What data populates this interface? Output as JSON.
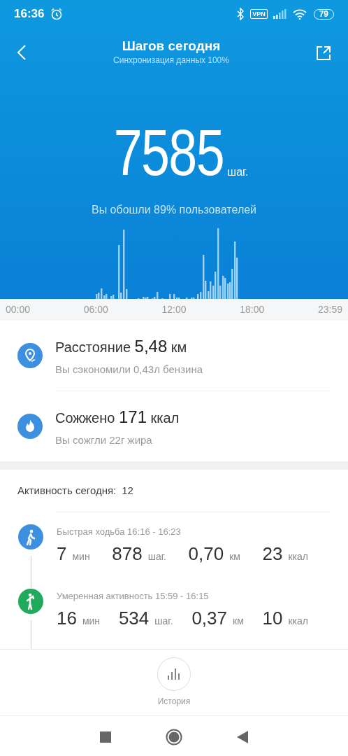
{
  "status_bar": {
    "time": "16:36",
    "vpn": "VPN",
    "battery": "79"
  },
  "header": {
    "title": "Шагов сегодня",
    "subtitle": "Синхронизация данных 100%"
  },
  "summary": {
    "steps": "7585",
    "unit": "шаг.",
    "comparison": "Вы обошли 89% пользователей"
  },
  "chart": {
    "time_labels": [
      "00:00",
      "06:00",
      "12:00",
      "18:00",
      "23:59"
    ]
  },
  "stats": [
    {
      "kind": "distance",
      "title": "Расстояние **5,48** км",
      "note": "Вы сэкономили 0,43л бензина"
    },
    {
      "kind": "calories",
      "title": "Сожжено **171** ккал",
      "note": "Вы сожгли 22г жира"
    }
  ],
  "activity": {
    "label": "Активность сегодня:",
    "count": "12",
    "items": [
      {
        "kind": "brisk_walk",
        "color": "#3d8fe0",
        "title": "Быстрая ходьба 16:16 - 16:23",
        "metrics": [
          {
            "value": "7",
            "unit": "мин"
          },
          {
            "value": "878",
            "unit": "шаг."
          },
          {
            "value": "0,70",
            "unit": "км"
          },
          {
            "value": "23",
            "unit": "ккал"
          }
        ]
      },
      {
        "kind": "moderate",
        "color": "#1faa5c",
        "title": "Умеренная активность 15:59 - 16:15",
        "metrics": [
          {
            "value": "16",
            "unit": "мин"
          },
          {
            "value": "534",
            "unit": "шаг."
          },
          {
            "value": "0,37",
            "unit": "км"
          },
          {
            "value": "10",
            "unit": "ккал"
          }
        ]
      }
    ]
  },
  "history_button": {
    "label": "История"
  }
}
